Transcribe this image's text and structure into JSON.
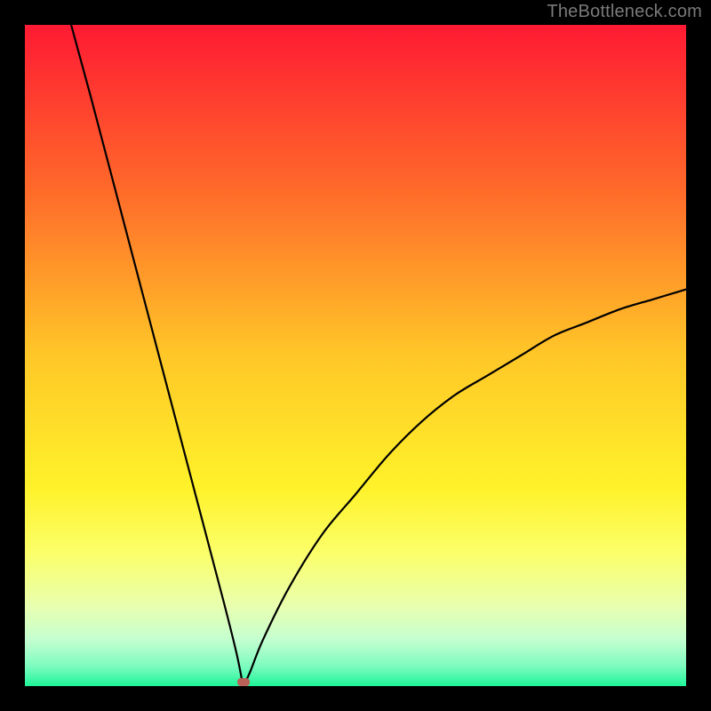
{
  "watermark": "TheBottleneck.com",
  "colors": {
    "bg": "#000000",
    "curve": "#000000",
    "marker": "#b96058",
    "watermark_text": "#7a7a7a",
    "gradient_stops": [
      {
        "pos": 0.0,
        "color": "#ff1a33"
      },
      {
        "pos": 0.25,
        "color": "#ff6a2a"
      },
      {
        "pos": 0.5,
        "color": "#ffc728"
      },
      {
        "pos": 0.7,
        "color": "#fff22a"
      },
      {
        "pos": 0.8,
        "color": "#fbff6a"
      },
      {
        "pos": 0.88,
        "color": "#e8ffb0"
      },
      {
        "pos": 0.93,
        "color": "#c4ffd0"
      },
      {
        "pos": 0.97,
        "color": "#7dfbc0"
      },
      {
        "pos": 1.0,
        "color": "#1ef598"
      }
    ]
  },
  "chart_data": {
    "type": "line",
    "title": "",
    "xlabel": "",
    "ylabel": "",
    "xlim": [
      0,
      100
    ],
    "ylim": [
      0,
      100
    ],
    "notes": "V-shaped bottleneck curve. Left branch is near-linear descending from (~7,100) to the minimum. Right branch rises as a decelerating concave curve from the minimum toward (~100,60). Minimum bottleneck at x≈33, y≈0. Background heatmap encodes bottleneck severity from green (0) to red (100).",
    "series": [
      {
        "name": "bottleneck-curve",
        "x": [
          7,
          10,
          15,
          20,
          25,
          30,
          32,
          33,
          34,
          36,
          40,
          45,
          50,
          55,
          60,
          65,
          70,
          75,
          80,
          85,
          90,
          95,
          100
        ],
        "y": [
          100,
          89,
          70,
          51,
          32,
          13,
          5,
          0,
          2,
          7,
          15,
          23,
          29,
          35,
          40,
          44,
          47,
          50,
          53,
          55,
          57,
          58.5,
          60
        ]
      }
    ],
    "marker": {
      "x": 33,
      "y": 0
    }
  }
}
